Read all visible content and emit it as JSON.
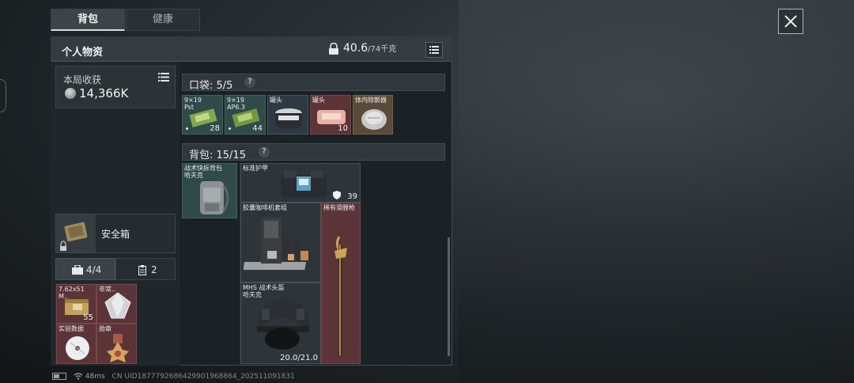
{
  "tabs": [
    {
      "label": "背包",
      "active": true
    },
    {
      "label": "健康",
      "active": false
    }
  ],
  "header": {
    "title": "个人物资",
    "weight_current": "40.6",
    "weight_max": "/74千克"
  },
  "earnings": {
    "label": "本局收获",
    "value": "14,366K"
  },
  "safe_box": {
    "label": "安全箱",
    "tab_a": "4/4",
    "tab_b": "2"
  },
  "safe_items": [
    {
      "name": "7.62x51",
      "sub": "M..",
      "count": "55",
      "color": "red"
    },
    {
      "name": "非常..",
      "sub": "",
      "count": "",
      "color": "red"
    },
    {
      "name": "实验数据",
      "sub": "",
      "count": "",
      "color": "red"
    },
    {
      "name": "勋章",
      "sub": "",
      "count": "",
      "color": "red"
    }
  ],
  "pocket": {
    "label": "口袋: 5/5",
    "help": "?",
    "items": [
      {
        "name": "9×19",
        "sub": "Pst",
        "count": "28",
        "color": "grn"
      },
      {
        "name": "9×19",
        "sub": "AP6.3",
        "count": "44",
        "color": "grn"
      },
      {
        "name": "罐头",
        "sub": "",
        "count": "",
        "color": "blu"
      },
      {
        "name": "罐头",
        "sub": "",
        "count": "10",
        "color": "red"
      },
      {
        "name": "体内除颤器",
        "sub": "",
        "count": "",
        "color": "tan"
      }
    ]
  },
  "backpack": {
    "label": "背包: 15/15",
    "help": "?",
    "items": [
      {
        "name": "战术快拆背包",
        "sub": "哈夫克",
        "count": "",
        "color": "grn"
      },
      {
        "name": "标准护甲",
        "sub": "",
        "count": "39",
        "color": "gry"
      },
      {
        "name": "胶囊咖啡机套组",
        "sub": "",
        "count": "",
        "color": "gry"
      },
      {
        "name": "稀有滑膛枪",
        "sub": "",
        "count": "",
        "color": "red"
      },
      {
        "name": "MHS 战术头盔",
        "sub": "哈夫克",
        "count": "20.0/21.0",
        "color": "gry"
      }
    ]
  },
  "status_bar": {
    "ping": "48ms",
    "uid": "CN UID1877792686429901968864_202511091831"
  }
}
